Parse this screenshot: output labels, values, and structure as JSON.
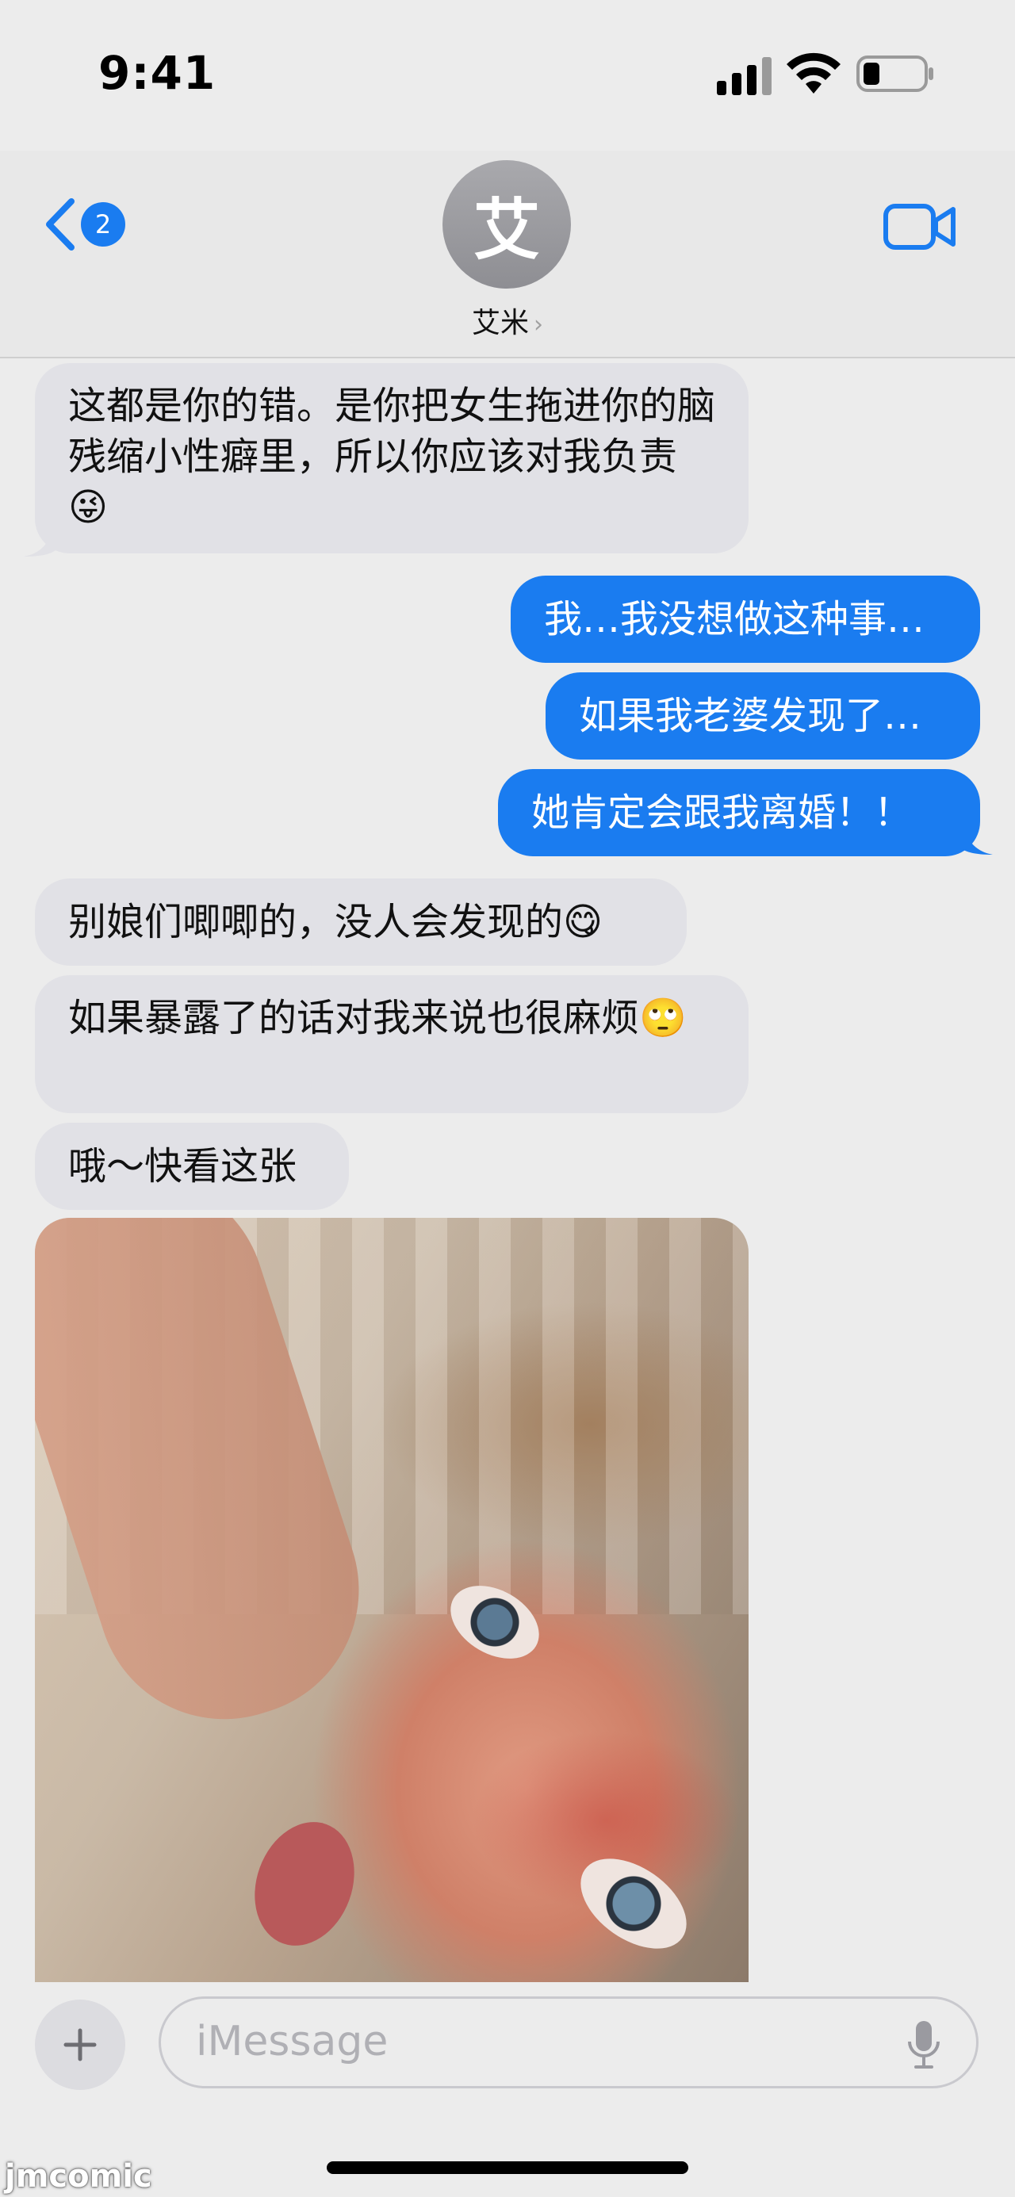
{
  "status_bar": {
    "time": "9:41"
  },
  "header": {
    "back_badge": "2",
    "avatar_initial": "艾",
    "contact_name": "艾米",
    "contact_chevron": "›"
  },
  "messages": [
    {
      "side": "in",
      "text": "这都是你的错。是你把女生拖进你的脑残缩小性癖里，所以你应该对我负责😜"
    },
    {
      "side": "out",
      "text": "我…我没想做这种事…"
    },
    {
      "side": "out",
      "text": "如果我老婆发现了…"
    },
    {
      "side": "out",
      "text": "她肯定会跟我离婚！！"
    },
    {
      "side": "in",
      "text": "别娘们唧唧的，没人会发现的😋"
    },
    {
      "side": "in",
      "text": "如果暴露了的话对我来说也很麻烦🙄"
    },
    {
      "side": "in",
      "text": "哦～快看这张"
    }
  ],
  "input": {
    "placeholder": "iMessage"
  },
  "watermark": "jmcomic",
  "colors": {
    "accent": "#1a7cf0",
    "incoming_bubble": "#e1e1e6",
    "background": "#ececec"
  },
  "icons": [
    "back-chevron-icon",
    "video-camera-icon",
    "plus-icon",
    "microphone-icon",
    "signal-icon",
    "wifi-icon",
    "battery-icon"
  ]
}
